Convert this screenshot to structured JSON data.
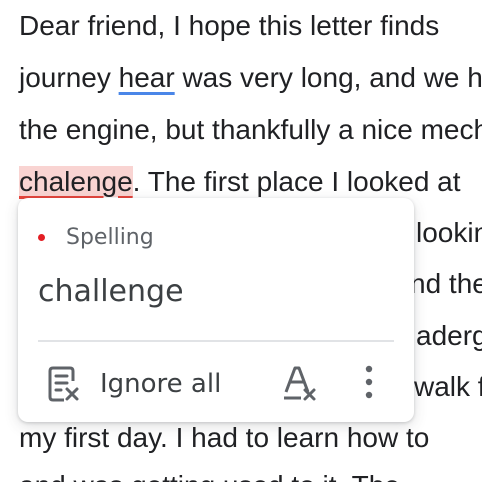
{
  "document": {
    "line1": "Dear friend, I hope this letter finds",
    "line2_before": "journey ",
    "line2_flagged": "hear",
    "line2_after": " was very long, and we had trouble with",
    "line3": "the engine, but thankfully a nice mechanic",
    "line4_flagged": "chalenge",
    "line4_after": ". The first place I looked at",
    "line5_tail": "looking",
    "line6_tail": "nd the",
    "line7_tail": "aderg",
    "line8_tail": "walk f",
    "line9": "my first day. I had to learn how to",
    "line10": "and was getting used to it. The"
  },
  "popup": {
    "category": "Spelling",
    "category_color": "#e31e24",
    "suggestion": "challenge",
    "ignore_all_label": "Ignore all",
    "ignore_icon": "ignore-document-icon",
    "clear_format_icon": "clear-formatting-icon",
    "more_icon": "more-vert-icon"
  },
  "colors": {
    "spelling_underline": "#e8453c",
    "grammar_underline": "#4a86e8",
    "active_highlight": "#f9d4d2"
  }
}
